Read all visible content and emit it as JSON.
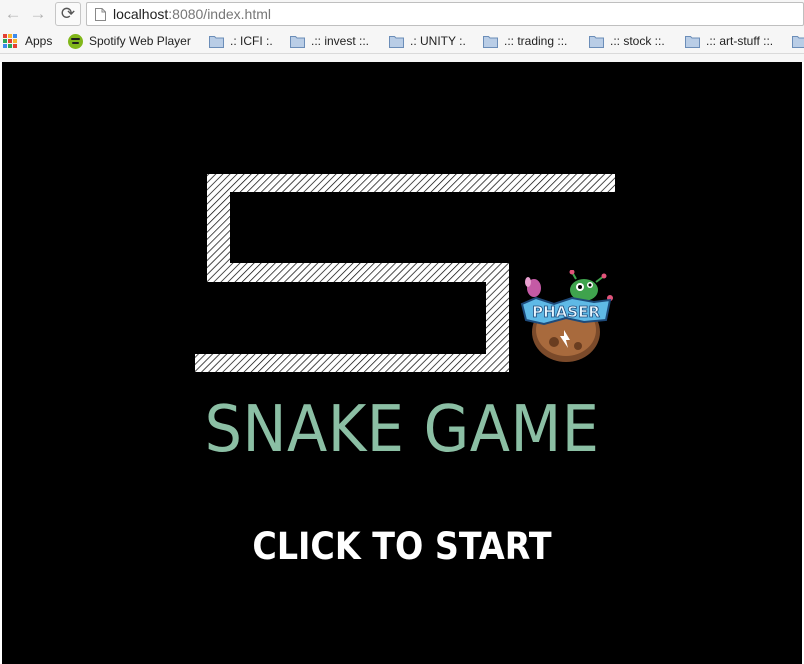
{
  "browser": {
    "url_host": "localhost",
    "url_rest": ":8080/index.html",
    "bookmarks": [
      {
        "label": "Apps",
        "icon": "apps-icon"
      },
      {
        "label": "Spotify Web Player",
        "icon": "spotify-icon"
      },
      {
        "label": ".: ICFI :.",
        "icon": "folder-icon"
      },
      {
        "label": ".:: invest ::.",
        "icon": "folder-icon"
      },
      {
        "label": ".: UNITY :.",
        "icon": "folder-icon"
      },
      {
        "label": ".:: trading ::.",
        "icon": "folder-icon"
      },
      {
        "label": ".:: stock ::.",
        "icon": "folder-icon"
      },
      {
        "label": ".:: art-stuff ::.",
        "icon": "folder-icon"
      }
    ]
  },
  "game": {
    "title": "SNAKE GAME",
    "start_label": "CLICK TO START",
    "title_color": "#8bbfa4",
    "start_color": "#ffffff",
    "background": "#000000"
  },
  "colors": {
    "folder": "#8fb0d6",
    "snake_stripe": "#000000",
    "snake_fill": "#ffffff"
  }
}
